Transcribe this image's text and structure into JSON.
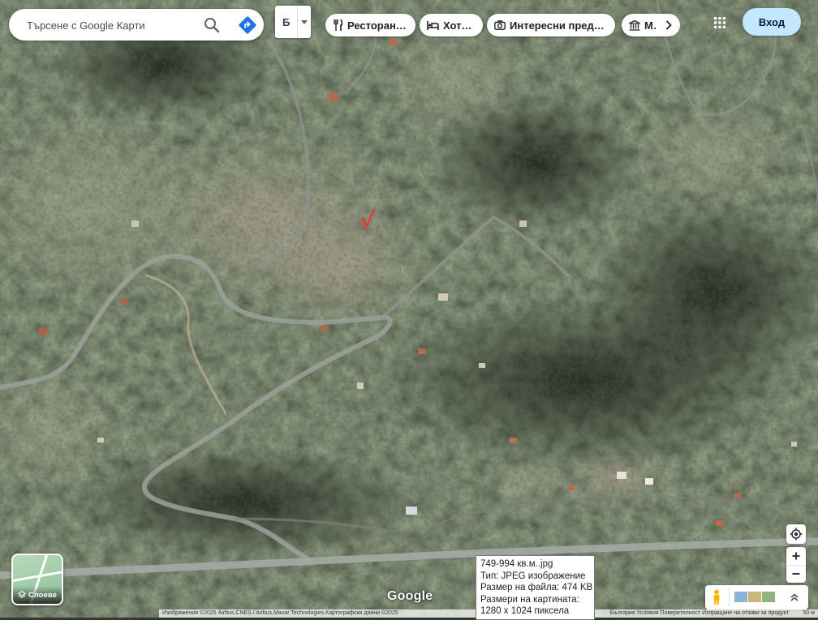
{
  "search": {
    "placeholder": "Търсене с Google Карти"
  },
  "ime": {
    "label": "Б"
  },
  "chips": [
    {
      "label": "Ресторанти",
      "icon": "fork-knife-icon"
    },
    {
      "label": "Хотели",
      "icon": "bed-icon"
    },
    {
      "label": "Интересни предло...",
      "icon": "camera-icon"
    },
    {
      "label": "Муз",
      "icon": "museum-icon"
    }
  ],
  "header": {
    "signin_label": "Вход"
  },
  "layers": {
    "label": "Слоеве"
  },
  "logo": {
    "text": "Google"
  },
  "attribution": {
    "text": "Изображения ©2025 Airbus,CNES / Airbus,Maxar Technologies,Картографски данни ©2025",
    "right_text": "България   Условия   Поверителност   Изпращане на отзиви за продукт",
    "scale": "50 м"
  },
  "tooltip": {
    "lines": [
      "749-994 кв.м..jpg",
      "Тип: JPEG изображение",
      "Размер на файла: 474 KB",
      "Размери на картината:",
      "1280 x 1024 пиксела"
    ]
  },
  "annotation": {
    "mark": "√"
  },
  "colors": {
    "signin_bg": "#c2e7ff",
    "directions_blue": "#1a73e8",
    "annotation_red": "#e53935"
  }
}
